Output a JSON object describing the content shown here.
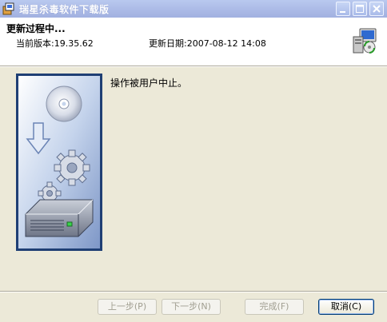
{
  "window": {
    "title": "瑞星杀毒软件下载版",
    "app_icon": "installer-box-icon"
  },
  "header": {
    "title": "更新过程中...",
    "current_version": "当前版本:19.35.62",
    "update_date": "更新日期:2007-08-12 14:08",
    "icon": "computer-update-icon"
  },
  "content": {
    "message": "操作被用户中止。",
    "side_image": "cd-to-disk-gears-illustration"
  },
  "buttons": {
    "back": "上一步(P)",
    "next": "下一步(N)",
    "finish": "完成(F)",
    "cancel": "取消(C)"
  },
  "colors": {
    "titlebar": "#aebde8",
    "dialog_bg": "#ece9d8",
    "header_bg": "#ffffff"
  }
}
